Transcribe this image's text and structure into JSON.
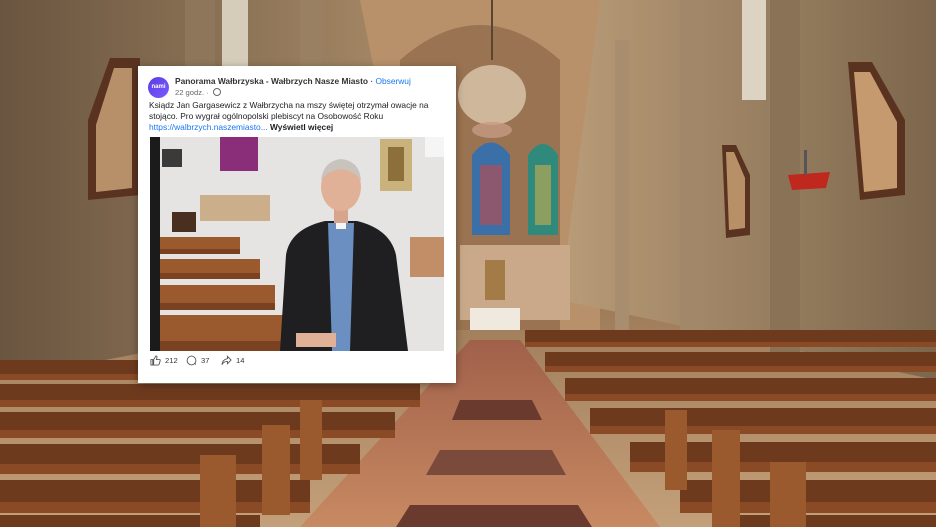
{
  "post": {
    "page_name": "Panorama Wałbrzyska - Wałbrzych Nasze Miasto",
    "separator": "·",
    "follow_label": "Obserwuj",
    "time_label": "22 godz.",
    "avatar_label": "nami",
    "text": "Ksiądz Jan Gargasewicz z Wałbrzycha na mszy świętej otrzymał owacje na stojąco. Pro wygrał ogólnopolski plebiscyt na Osobowość Roku",
    "link_text": "https://walbrzych.naszemiasto...",
    "see_more_label": "Wyświetl więcej",
    "reactions": {
      "likes": "212",
      "comments": "37",
      "shares": "14"
    }
  },
  "icons": {
    "like": "thumbs-up-icon",
    "comment": "comment-bubble-icon",
    "share": "share-arrow-icon",
    "audience": "globe-icon"
  },
  "colors": {
    "link": "#1877f2",
    "muted": "#65676b",
    "avatar": "#5b3ce0"
  }
}
